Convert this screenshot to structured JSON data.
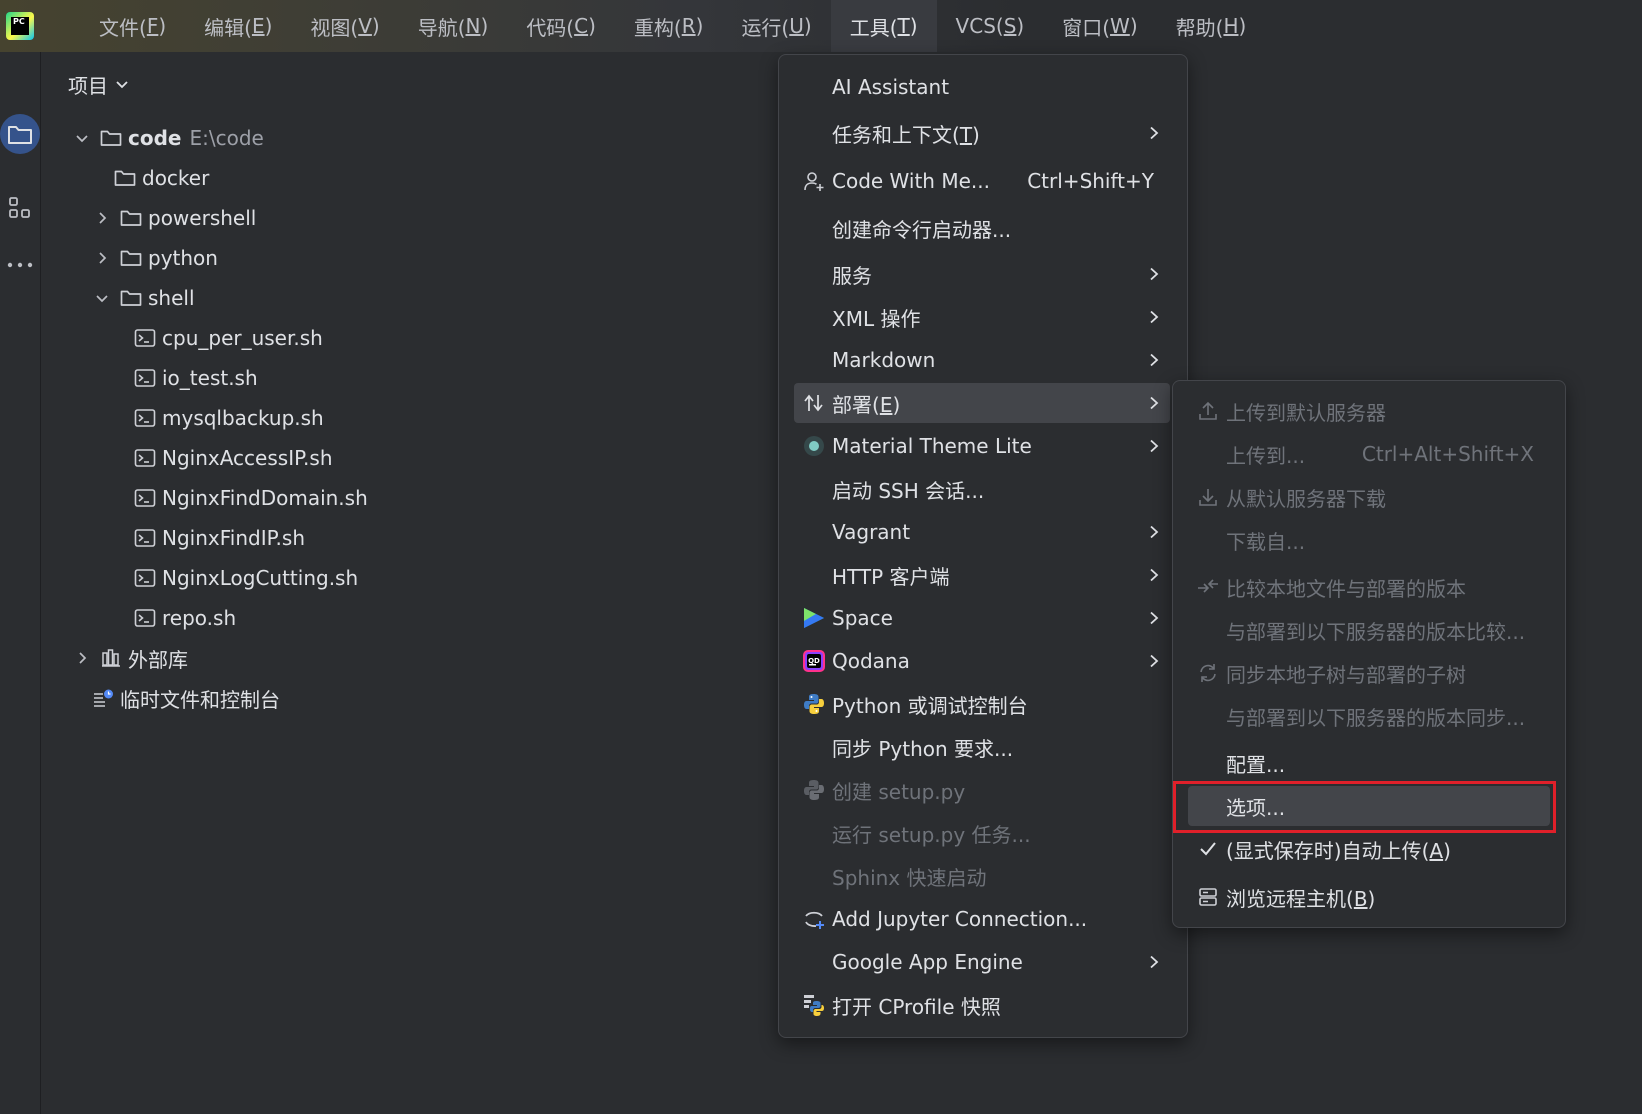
{
  "menubar": {
    "items": [
      {
        "label": "文件(",
        "mn": "F",
        "end": ")"
      },
      {
        "label": "编辑(",
        "mn": "E",
        "end": ")"
      },
      {
        "label": "视图(",
        "mn": "V",
        "end": ")"
      },
      {
        "label": "导航(",
        "mn": "N",
        "end": ")"
      },
      {
        "label": "代码(",
        "mn": "C",
        "end": ")"
      },
      {
        "label": "重构(",
        "mn": "R",
        "end": ")"
      },
      {
        "label": "运行(",
        "mn": "U",
        "end": ")"
      },
      {
        "label": "工具(",
        "mn": "T",
        "end": ")"
      },
      {
        "label": "VCS(",
        "mn": "S",
        "end": ")"
      },
      {
        "label": "窗口(",
        "mn": "W",
        "end": ")"
      },
      {
        "label": "帮助(",
        "mn": "H",
        "end": ")"
      }
    ],
    "active_index": 7,
    "logo_text": "PC"
  },
  "project_panel": {
    "title": "项目",
    "tree": [
      {
        "label": "code",
        "path": "E:\\code",
        "type": "folder",
        "expanded": true
      },
      {
        "label": "docker",
        "type": "folder"
      },
      {
        "label": "powershell",
        "type": "folder",
        "collapsed": true
      },
      {
        "label": "python",
        "type": "folder",
        "collapsed": true
      },
      {
        "label": "shell",
        "type": "folder",
        "expanded": true
      },
      {
        "label": "cpu_per_user.sh",
        "type": "script"
      },
      {
        "label": "io_test.sh",
        "type": "script"
      },
      {
        "label": "mysqlbackup.sh",
        "type": "script"
      },
      {
        "label": "NginxAccessIP.sh",
        "type": "script"
      },
      {
        "label": "NginxFindDomain.sh",
        "type": "script"
      },
      {
        "label": "NginxFindIP.sh",
        "type": "script"
      },
      {
        "label": "NginxLogCutting.sh",
        "type": "script"
      },
      {
        "label": "repo.sh",
        "type": "script"
      },
      {
        "label": "外部库",
        "type": "library",
        "collapsed": true
      },
      {
        "label": "临时文件和控制台",
        "type": "scratch"
      }
    ]
  },
  "tools_menu": {
    "items": [
      {
        "label": "AI Assistant"
      },
      {
        "label": "任务和上下文(",
        "mn": "T",
        "end": ")",
        "submenu": true
      },
      {
        "label": "Code With Me...",
        "shortcut": "Ctrl+Shift+Y",
        "icon": "person-add-icon"
      },
      {
        "label": "创建命令行启动器..."
      },
      {
        "label": "服务",
        "submenu": true
      },
      {
        "label": "XML 操作",
        "submenu": true
      },
      {
        "label": "Markdown",
        "submenu": true
      },
      {
        "label": "部署(",
        "mn": "E",
        "end": ")",
        "submenu": true,
        "highlighted": true,
        "icon": "deploy-icon"
      },
      {
        "label": "Material Theme Lite",
        "submenu": true,
        "icon": "material-theme-icon"
      },
      {
        "label": "启动 SSH 会话..."
      },
      {
        "label": "Vagrant",
        "submenu": true
      },
      {
        "label": "HTTP 客户端",
        "submenu": true
      },
      {
        "label": "Space",
        "submenu": true,
        "icon": "space-icon"
      },
      {
        "label": "Qodana",
        "submenu": true,
        "icon": "qodana-icon"
      },
      {
        "label": "Python 或调试控制台",
        "icon": "python-icon"
      },
      {
        "label": "同步 Python 要求..."
      },
      {
        "label": "创建 setup.py",
        "disabled": true,
        "icon": "python-gray-icon"
      },
      {
        "label": "运行 setup.py 任务...",
        "disabled": true
      },
      {
        "label": "Sphinx 快速启动",
        "disabled": true
      },
      {
        "label": "Add Jupyter Connection...",
        "icon": "jupyter-icon"
      },
      {
        "label": "Google App Engine",
        "submenu": true
      },
      {
        "label": "打开 CProfile 快照",
        "icon": "cprofile-icon"
      }
    ]
  },
  "deploy_submenu": {
    "items": [
      {
        "label": "上传到默认服务器",
        "disabled": true,
        "icon": "upload-icon"
      },
      {
        "label": "上传到...",
        "disabled": true,
        "shortcut": "Ctrl+Alt+Shift+X"
      },
      {
        "label": "从默认服务器下载",
        "disabled": true,
        "icon": "download-icon"
      },
      {
        "label": "下载自...",
        "disabled": true
      },
      {
        "label": "比较本地文件与部署的版本",
        "disabled": true,
        "icon": "compare-icon"
      },
      {
        "label": "与部署到以下服务器的版本比较...",
        "disabled": true
      },
      {
        "label": "同步本地子树与部署的子树",
        "disabled": true,
        "icon": "sync-icon"
      },
      {
        "label": "与部署到以下服务器的版本同步...",
        "disabled": true
      },
      {
        "label": "配置..."
      },
      {
        "label": "选项...",
        "highlighted": true
      },
      {
        "label": "(显式保存时)自动上传(",
        "mn": "A",
        "end": ")",
        "icon": "check-icon"
      },
      {
        "label": "浏览远程主机(",
        "mn": "B",
        "end": ")",
        "icon": "server-icon"
      }
    ]
  },
  "colors": {
    "background": "#2b2d30",
    "highlight": "#43454a",
    "annotation_box": "#e0202a",
    "selected_tool": "#35538b"
  }
}
